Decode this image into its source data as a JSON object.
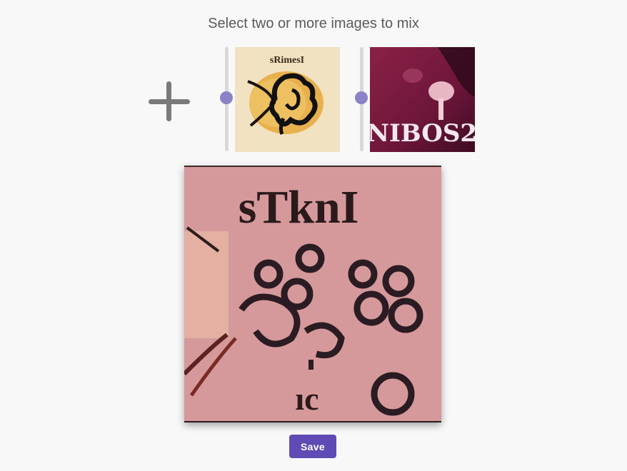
{
  "header": {
    "title": "Select two or more images to mix"
  },
  "add_button": {
    "icon": "plus-icon",
    "color": "#7a7a7a"
  },
  "source_images": [
    {
      "slider_value": 0.5,
      "caption": "sRimesI",
      "accent": "#f2e3c4"
    },
    {
      "slider_value": 0.5,
      "caption": "NIBOS2",
      "accent": "#6e1a3c"
    }
  ],
  "result": {
    "caption": "sTknI",
    "accent": "#d89a9c"
  },
  "actions": {
    "save_label": "Save",
    "save_color": "#5f4bb3"
  },
  "colors": {
    "slider_thumb": "#8b82c7",
    "slider_track": "#d9d9dc",
    "background": "#f8f8f9"
  }
}
